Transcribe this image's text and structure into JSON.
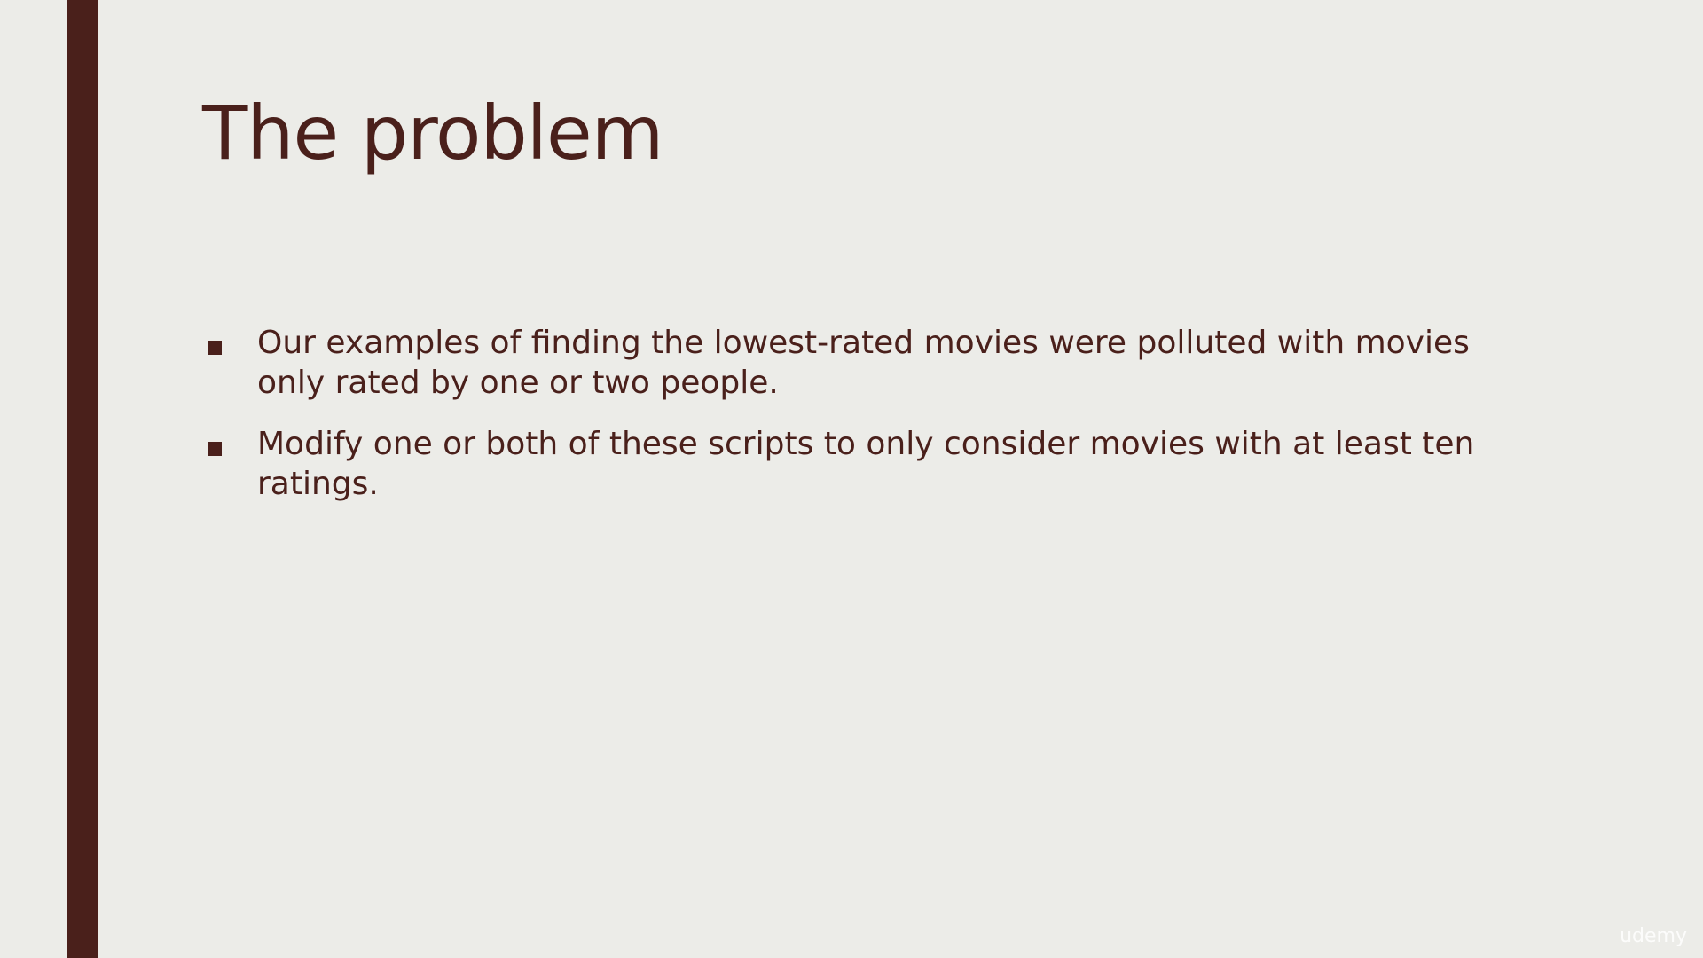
{
  "slide": {
    "title": "The problem",
    "bullets": [
      {
        "text": "Our examples of finding the lowest-rated movies were polluted with movies only rated by one or two people."
      },
      {
        "text": "Modify one or both of these scripts to only consider movies with at least ten ratings."
      }
    ],
    "watermark": "udemy"
  },
  "colors": {
    "background": "#ECECE8",
    "accent": "#4A201B",
    "text": "#4A201B"
  },
  "icons": {
    "bullet": "square-bullet-icon"
  }
}
